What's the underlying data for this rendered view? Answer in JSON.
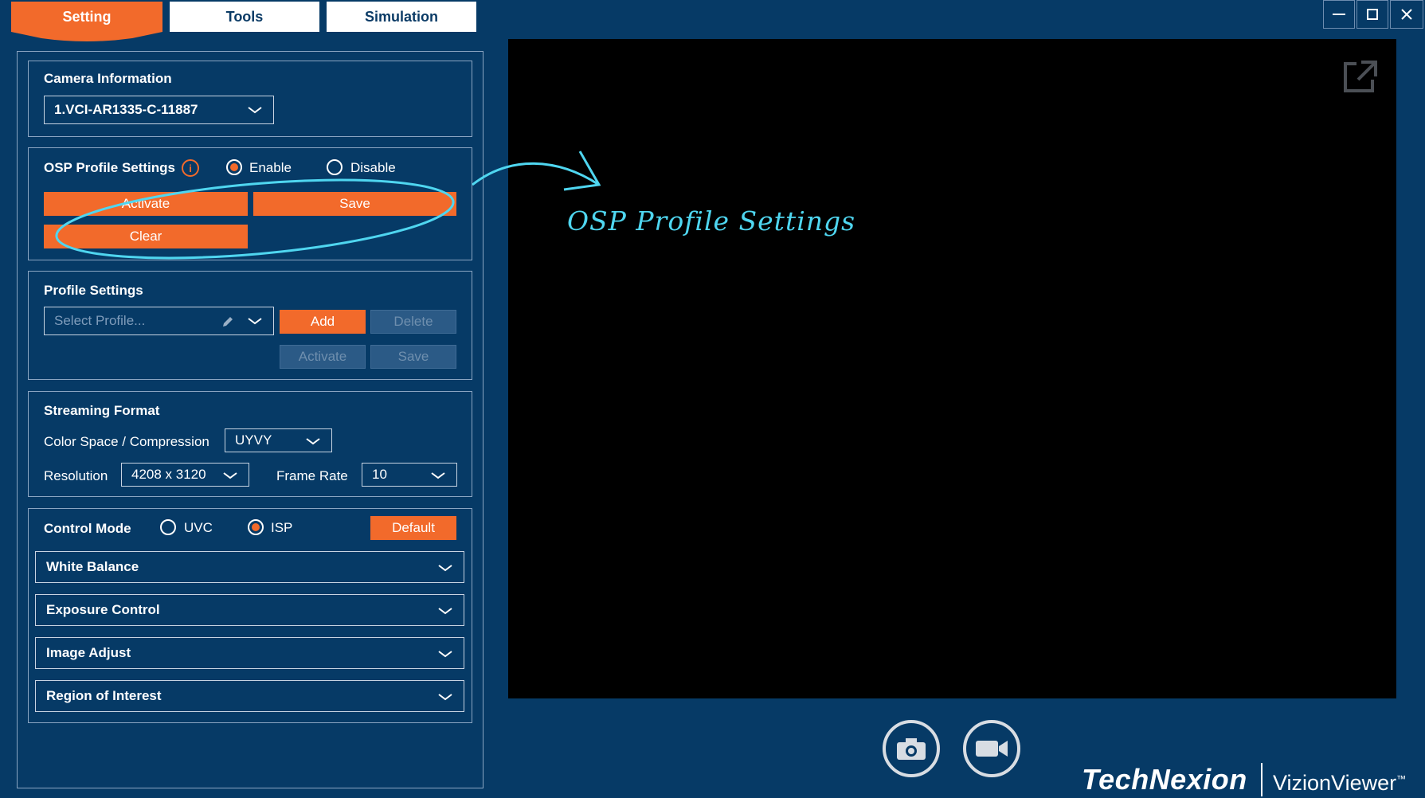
{
  "tabs": {
    "setting": "Setting",
    "tools": "Tools",
    "simulation": "Simulation"
  },
  "window_controls": {
    "minimize": "—",
    "maximize": "☐",
    "close": "✕"
  },
  "camera_info": {
    "title": "Camera Information",
    "selected": "1.VCI-AR1335-C-11887"
  },
  "osp": {
    "title": "OSP Profile Settings",
    "enable_label": "Enable",
    "disable_label": "Disable",
    "selected_mode": "Enable",
    "activate": "Activate",
    "save": "Save",
    "clear": "Clear"
  },
  "profile_settings": {
    "title": "Profile Settings",
    "placeholder": "Select Profile...",
    "add": "Add",
    "delete": "Delete",
    "activate": "Activate",
    "save": "Save"
  },
  "streaming_format": {
    "title": "Streaming Format",
    "color_space_label": "Color Space / Compression",
    "color_space_value": "UYVY",
    "resolution_label": "Resolution",
    "resolution_value": "4208 x 3120",
    "frame_rate_label": "Frame Rate",
    "frame_rate_value": "10"
  },
  "control_mode": {
    "title": "Control Mode",
    "uvc_label": "UVC",
    "isp_label": "ISP",
    "selected": "ISP",
    "default_button": "Default",
    "sections": [
      "White Balance",
      "Exposure Control",
      "Image Adjust",
      "Region of Interest"
    ]
  },
  "annotation": {
    "text": "OSP Profile Settings",
    "color": "#4fd6f0"
  },
  "brand": {
    "company": "TechNexion",
    "product": "VizionViewer",
    "tm": "™"
  },
  "colors": {
    "background": "#063a66",
    "accent": "#f26a2b",
    "preview": "#000000"
  }
}
